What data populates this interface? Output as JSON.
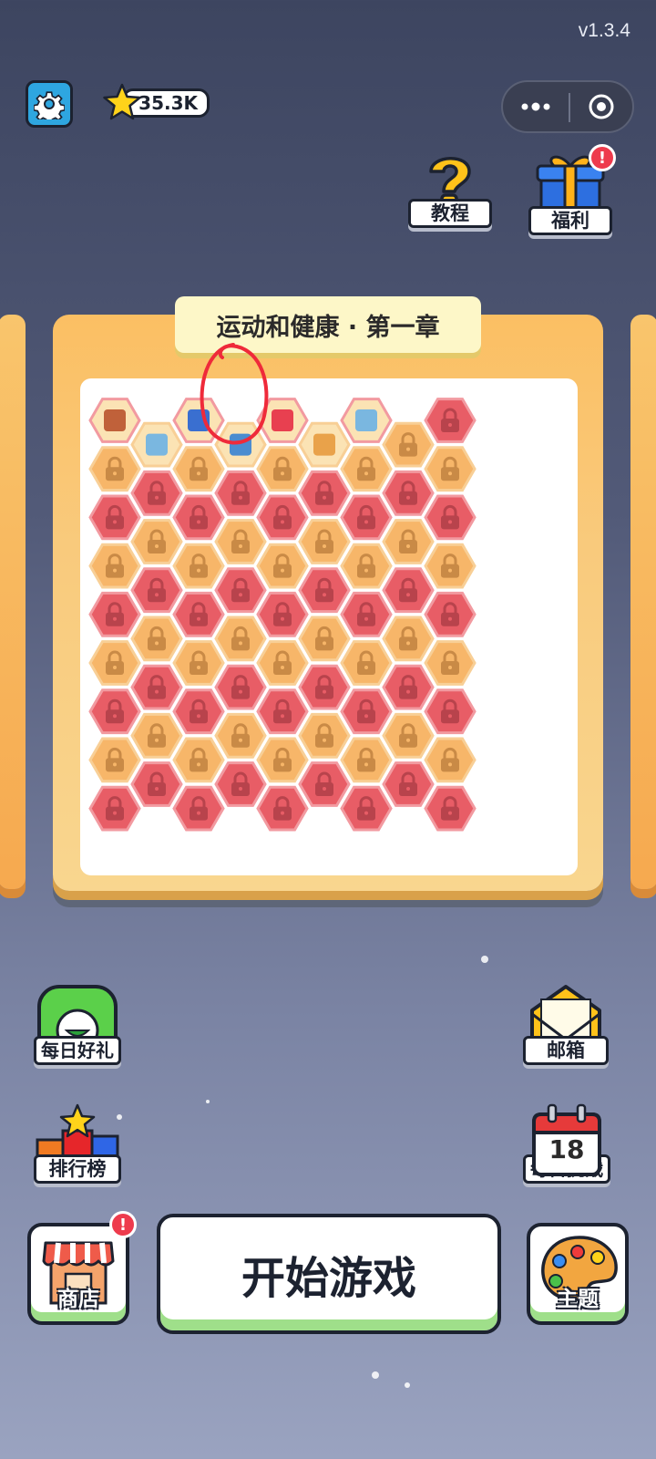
{
  "version": "v1.3.4",
  "header": {
    "coins": "35.3K"
  },
  "top_buttons": {
    "tutorial": "教程",
    "welfare": "福利",
    "welfare_badge": "!"
  },
  "level_card": {
    "title": "运动和健康 · 第一章",
    "board": {
      "rows": 17,
      "row_counts": [
        5,
        4,
        5,
        4,
        5,
        4,
        5,
        4,
        5,
        4,
        5,
        4,
        5,
        4,
        5,
        4,
        5
      ],
      "unlocked_cells": [
        {
          "row": 0,
          "col": 0,
          "icon": "shoe-icon"
        },
        {
          "row": 0,
          "col": 1,
          "icon": "boxing-glove-icon"
        },
        {
          "row": 1,
          "col": 0,
          "icon": "jump-rope-icon"
        },
        {
          "row": 1,
          "col": 1,
          "icon": "bathtub-icon"
        },
        {
          "row": 0,
          "col": 2,
          "icon": "athlete-icon"
        },
        {
          "row": 1,
          "col": 2,
          "icon": "runner-icon"
        },
        {
          "row": 0,
          "col": 3,
          "icon": "dumbbell-icon"
        }
      ],
      "colors": {
        "red_cell": "#e85d66",
        "orange_cell": "#f7b669",
        "lock": "#b04a52"
      }
    }
  },
  "side_buttons": {
    "daily_gift": "每日好礼",
    "mailbox": "邮箱",
    "leaderboard": "排行榜",
    "daily_challenge": "每日挑战",
    "calendar_day": "18"
  },
  "bottom_bar": {
    "shop": "商店",
    "shop_badge": "!",
    "start": "开始游戏",
    "theme": "主题"
  }
}
